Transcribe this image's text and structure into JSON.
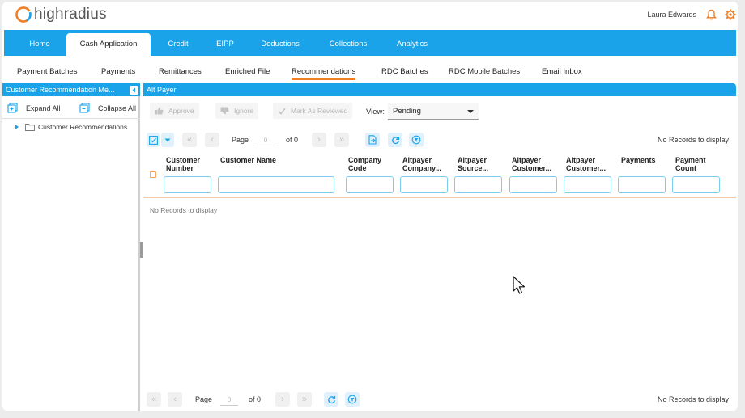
{
  "brand": {
    "name": "highradius",
    "accent": "#1aa3e8",
    "orange": "#f07e24"
  },
  "header": {
    "user": "Laura Edwards",
    "bell_icon": "bell-icon",
    "settings_icon": "gear-icon"
  },
  "main_tabs": [
    "Home",
    "Cash Application",
    "Credit",
    "EIPP",
    "Deductions",
    "Collections",
    "Analytics"
  ],
  "active_main_tab": "Cash Application",
  "sub_tabs": [
    "Payment Batches",
    "Payments",
    "Remittances",
    "Enriched File",
    "Recommendations",
    "RDC Batches",
    "RDC Mobile Batches",
    "Email Inbox"
  ],
  "active_sub_tab": "Recommendations",
  "left_panel": {
    "title": "Customer Recommendation Me...",
    "expand_all": "Expand All",
    "collapse_all": "Collapse All",
    "tree_root": "Customer Recommendations"
  },
  "right_panel": {
    "title": "Alt Payer",
    "actions": {
      "approve": "Approve",
      "ignore": "Ignore",
      "mark_reviewed": "Mark As Reviewed"
    },
    "view_label": "View:",
    "view_value": "Pending",
    "pager": {
      "page_label": "Page",
      "page_value": "0",
      "of_label": "of 0",
      "no_records": "No Records to display"
    },
    "columns": [
      [
        "Customer",
        "Number"
      ],
      [
        "Customer Name",
        ""
      ],
      [
        "Company",
        "Code"
      ],
      [
        "Altpayer",
        "Company..."
      ],
      [
        "Altpayer",
        "Source..."
      ],
      [
        "Altpayer",
        "Customer..."
      ],
      [
        "Altpayer",
        "Customer..."
      ],
      [
        "Payments",
        ""
      ],
      [
        "Payment",
        "Count"
      ]
    ],
    "empty_message": "No Records to display"
  }
}
